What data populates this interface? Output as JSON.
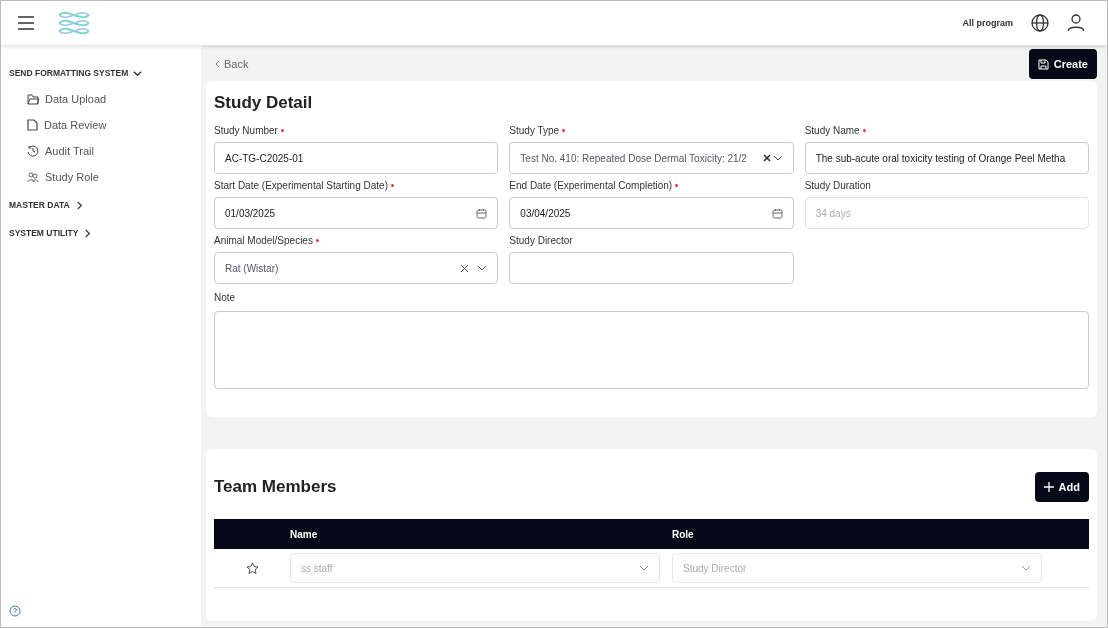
{
  "header": {
    "program": "All program"
  },
  "sidebar": {
    "sections": [
      {
        "label": "SEND FORMATTING SYSTEM",
        "expanded": true,
        "items": [
          {
            "label": "Data Upload"
          },
          {
            "label": "Data Review"
          },
          {
            "label": "Audit Trail"
          },
          {
            "label": "Study Role"
          }
        ]
      },
      {
        "label": "MASTER DATA",
        "expanded": false
      },
      {
        "label": "SYSTEM UTILITY",
        "expanded": false
      }
    ]
  },
  "back": "Back",
  "create": "Create",
  "study_detail": {
    "title": "Study Detail",
    "fields": [
      {
        "label": "Study Number",
        "required": true,
        "kind": "text",
        "value": "AC-TG-C2025-01",
        "disabled": false
      },
      {
        "label": "Study Type",
        "required": true,
        "kind": "select-clear",
        "value": "Test No. 410: Repeated Dose Dermal Toxicity: 21/2",
        "disabled": false
      },
      {
        "label": "Study Name",
        "required": true,
        "kind": "text",
        "value": "The sub-acute oral toxicity testing of Orange Peel Metha",
        "disabled": false
      },
      {
        "label": "Start Date (Experimental Starting Date)",
        "required": true,
        "kind": "date",
        "value": "01/03/2025",
        "disabled": false
      },
      {
        "label": "End Date (Experimental Completion)",
        "required": true,
        "kind": "date",
        "value": "03/04/2025",
        "disabled": false
      },
      {
        "label": "Study Duration",
        "required": false,
        "kind": "text",
        "value": "34 days",
        "disabled": true
      },
      {
        "label": "Animal Model/Species",
        "required": true,
        "kind": "select-clear-caret",
        "value": "Rat (Wistar)",
        "disabled": false
      },
      {
        "label": "Study Director",
        "required": false,
        "kind": "text",
        "disabled": false
      }
    ],
    "note": {
      "label": "Note"
    }
  },
  "team": {
    "title": "Team Members",
    "add": "Add",
    "columns": [
      "Name",
      "Role"
    ],
    "rows": [
      {
        "name": "ss staff",
        "role": "Study Director",
        "disabled": true
      }
    ]
  }
}
